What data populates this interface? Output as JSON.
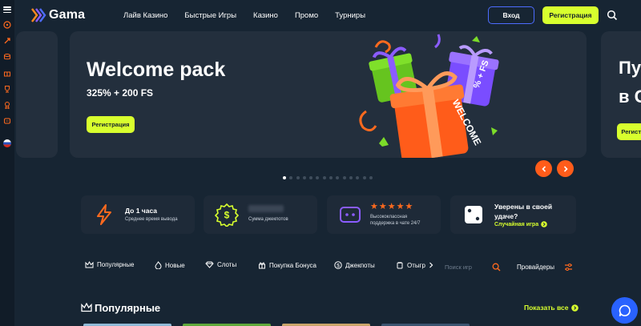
{
  "brand": {
    "name": "Gama",
    "accent": "#d8ff2e",
    "orange": "#ff5c1a",
    "blue": "#4d6cff"
  },
  "header": {
    "nav": [
      "Лайв Казино",
      "Быстрые Игры",
      "Казино",
      "Промо",
      "Турниры"
    ],
    "login_label": "Вход",
    "register_label": "Регистрация"
  },
  "sidebar": {
    "icons": [
      "wheel-icon",
      "rocket-icon",
      "coins-icon",
      "gift-icon",
      "trophy-icon",
      "medal-icon",
      "ticket-icon"
    ],
    "language_flag": "ru-flag-icon"
  },
  "hero": {
    "title": "Welcome pack",
    "subtitle": "325% + 200 FS",
    "button_label": "Регистрация",
    "next_slide_title": "Пу\nв С",
    "next_slide_button": "Регистр",
    "gift_labels": {
      "orange": "WELCOME",
      "purple": "% + FS"
    },
    "dots_total": 14,
    "dots_active_index": 0
  },
  "features": [
    {
      "title": "До 1 часа",
      "subtitle": "Среднее время вывода",
      "icon": "lightning-icon"
    },
    {
      "title": "",
      "subtitle": "Сумма джекпотов",
      "icon": "dollar-badge-icon"
    },
    {
      "title": "",
      "subtitle": "Высококлассная\nподдержка в чате 24/7",
      "icon": "chat-bubble-icon",
      "stars": 5
    },
    {
      "title": "Уверены в своей\nудаче?",
      "link": "Случайная игра",
      "icon": "dice-icon"
    }
  ],
  "categories": [
    {
      "label": "Популярные",
      "icon": "crown-icon"
    },
    {
      "label": "Новые",
      "icon": "flame-icon"
    },
    {
      "label": "Слоты",
      "icon": "diamond-icon"
    },
    {
      "label": "Покупка Бонуса",
      "icon": "gift-icon"
    },
    {
      "label": "Джекпоты",
      "icon": "dollar-icon"
    },
    {
      "label": "Отыгр",
      "icon": "wager-icon"
    }
  ],
  "catbar": {
    "search_placeholder": "Поиск игр",
    "providers_label": "Провайдеры"
  },
  "popular": {
    "title": "Популярные",
    "show_all": "Показать все"
  }
}
